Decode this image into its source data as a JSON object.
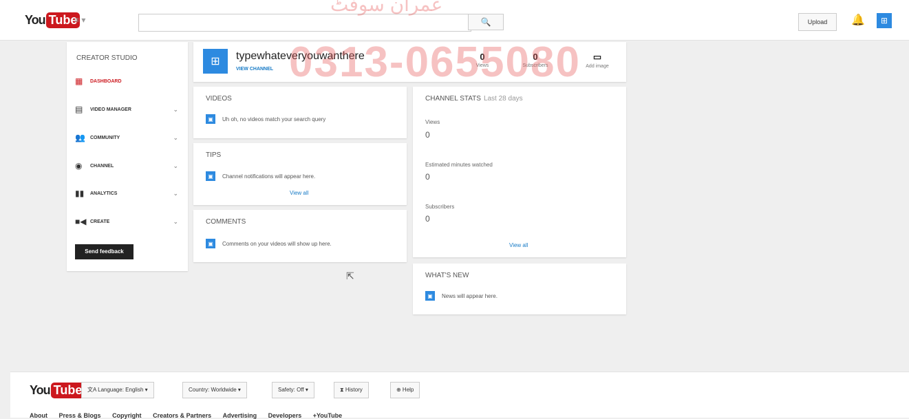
{
  "topbar": {
    "logo_you": "You",
    "logo_tube": "Tube",
    "guide_label": "≡ ▾",
    "search_placeholder": "",
    "search_icon": "🔍",
    "upload_label": "Upload",
    "bell_icon": "🔔",
    "avatar_glyph": "⊞"
  },
  "sidebar": {
    "title": "CREATOR STUDIO",
    "items": [
      {
        "label": "DASHBOARD",
        "icon": "dashboard-icon",
        "glyph": "▦",
        "active": true,
        "chevron": ""
      },
      {
        "label": "VIDEO MANAGER",
        "icon": "film-icon",
        "glyph": "▤",
        "active": false,
        "chevron": "⌄"
      },
      {
        "label": "COMMUNITY",
        "icon": "people-icon",
        "glyph": "👥",
        "active": false,
        "chevron": "⌄"
      },
      {
        "label": "CHANNEL",
        "icon": "user-icon",
        "glyph": "◉",
        "active": false,
        "chevron": "⌄"
      },
      {
        "label": "ANALYTICS",
        "icon": "chart-icon",
        "glyph": "▮▮",
        "active": false,
        "chevron": "⌄"
      },
      {
        "label": "CREATE",
        "icon": "camera-icon",
        "glyph": "■◀",
        "active": false,
        "chevron": "⌄"
      }
    ],
    "feedback_label": "Send feedback"
  },
  "channel": {
    "avatar_glyph": "⊞",
    "name": "typewhateveryouwanthere",
    "view_link": "VIEW CHANNEL",
    "views_num": "0",
    "views_label": "Views",
    "subs_num": "0",
    "subs_label": "Subscribers",
    "add_glyph": "▭",
    "add_label": "Add image"
  },
  "videos": {
    "title": "VIDEOS",
    "glyph": "▣",
    "message": "Uh oh, no videos match your search query"
  },
  "tips": {
    "title": "TIPS",
    "glyph": "▣",
    "message": "Channel notifications will appear here.",
    "view_all": "View all"
  },
  "comments": {
    "title": "COMMENTS",
    "glyph": "▣",
    "message": "Comments on your videos will show up here."
  },
  "channel_stats": {
    "title": "CHANNEL STATS",
    "period": "Last 28 days",
    "views_label": "Views",
    "views_value": "0",
    "minutes_label": "Estimated minutes watched",
    "minutes_value": "0",
    "subs_label": "Subscribers",
    "subs_value": "0",
    "view_all": "View all"
  },
  "whats_new": {
    "title": "WHAT'S NEW",
    "glyph": "▣",
    "message": "News will appear here."
  },
  "watermark": {
    "number": "0313-0655080",
    "script": "عمران سوفٹ"
  },
  "cursor_glyph": "⇱",
  "footer": {
    "logo_you": "You",
    "logo_tube": "Tube",
    "language": "文A Language: English ▾",
    "country": "Country: Worldwide ▾",
    "safety": "Safety: Off ▾",
    "history": "⧗ History",
    "help": "⊕ Help",
    "links": [
      "About",
      "Press & Blogs",
      "Copyright",
      "Creators & Partners",
      "Advertising",
      "Developers",
      "+YouTube"
    ]
  },
  "colors": {
    "brand_red": "#cc181e",
    "accent_blue": "#2d8ae0",
    "link_blue": "#167ac6"
  }
}
